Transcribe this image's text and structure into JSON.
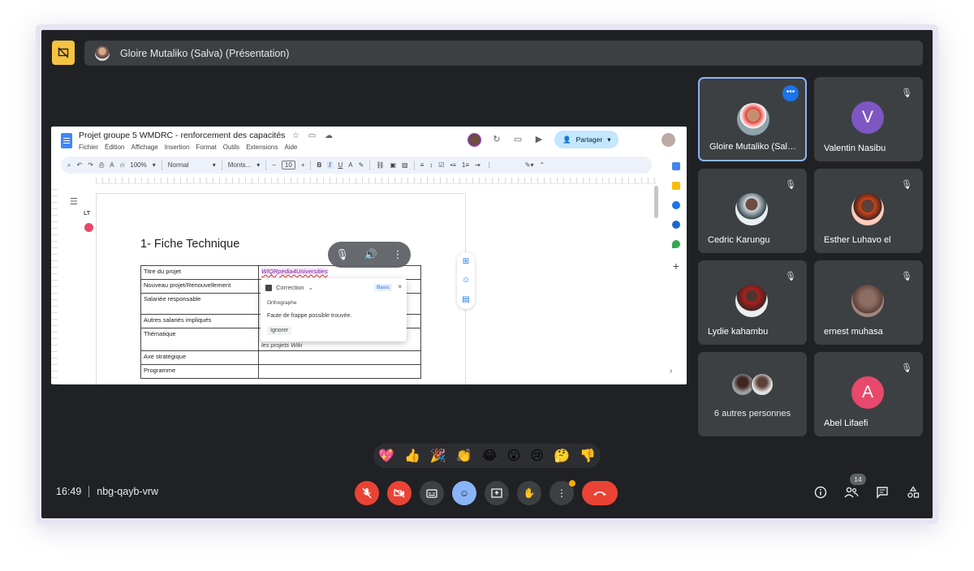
{
  "presenter_bar": {
    "name": "Gloire Mutaliko (Salva) (Présentation)"
  },
  "shared_doc": {
    "title": "Projet groupe 5 WMDRC - renforcement des capacités",
    "menu": [
      "Fichier",
      "Édition",
      "Affichage",
      "Insertion",
      "Format",
      "Outils",
      "Extensions",
      "Aide"
    ],
    "share_label": "Partager",
    "zoom": "100%",
    "style": "Normal",
    "font": "Monts...",
    "font_size": "10",
    "heading": "1- Fiche Technique",
    "table_rows": [
      {
        "label": "Titre du projet",
        "value": "WIQRpedia4Universities"
      },
      {
        "label": "Nouveau projet/Renouvellement",
        "value": ""
      },
      {
        "label": "Salariée responsable",
        "value": ""
      },
      {
        "label": "Autres salariés impliqués",
        "value": ""
      },
      {
        "label": "Thématique",
        "value": "les projets Wiki"
      },
      {
        "label": "Axe stratégique",
        "value": ""
      },
      {
        "label": "Programme",
        "value": ""
      }
    ],
    "correction_popup": {
      "title": "Correction",
      "badge": "Basic",
      "section": "Orthographe",
      "message": "Faute de frappe possible trouvée.",
      "ignore_label": "Ignorer"
    },
    "left_icon_label": "LT"
  },
  "participants": [
    {
      "name": "Gloire Mutaliko (Salva)",
      "type": "photo",
      "active": true
    },
    {
      "name": "Valentin Nasibu",
      "type": "letter",
      "letter": "V",
      "color": "#7e57c2"
    },
    {
      "name": "Cedric Karungu",
      "type": "photo"
    },
    {
      "name": "Esther Luhavo el",
      "type": "photo"
    },
    {
      "name": "Lydie kahambu",
      "type": "photo"
    },
    {
      "name": "ernest muhasa",
      "type": "photo"
    },
    {
      "others": "6 autres personnes"
    },
    {
      "name": "Abel Lifaefi",
      "type": "letter",
      "letter": "A",
      "color": "#e8486b"
    }
  ],
  "reactions": [
    "💖",
    "👍",
    "🎉",
    "👏",
    "😂",
    "😮",
    "😢",
    "🤔",
    "👎"
  ],
  "meeting": {
    "time": "16:49",
    "code": "nbg-qayb-vrw",
    "participant_count": "14"
  },
  "colors": {
    "accent": "#8ab4f8",
    "danger": "#ea4335",
    "warning": "#f5c242"
  }
}
